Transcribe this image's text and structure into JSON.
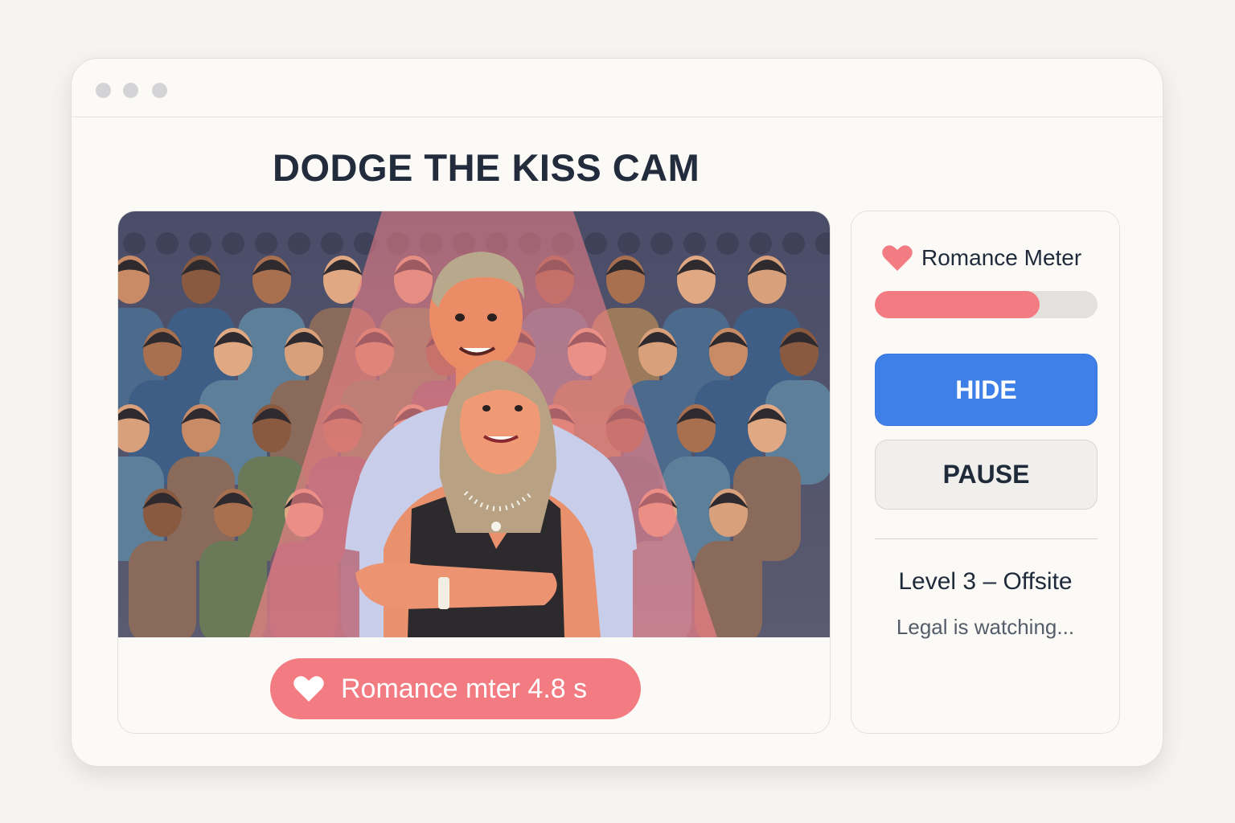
{
  "window": {
    "dots": [
      "window-dot",
      "window-dot",
      "window-dot"
    ]
  },
  "game": {
    "title": "DODGE THE KISS CAM",
    "pill_text": "Romance mter 4.8 s",
    "pill_icon": "heart-icon"
  },
  "sidebar": {
    "meter_label": "Romance Meter",
    "meter_icon": "heart-icon",
    "meter_level": 0.74,
    "hide_label": "HIDE",
    "pause_label": "PAUSE",
    "level_text": "Level 3 – Offsite",
    "status_text": "Legal is watching..."
  },
  "colors": {
    "accent_pink": "#f37b82",
    "accent_blue": "#3f7fe8",
    "spotlight": "#e87a80"
  }
}
